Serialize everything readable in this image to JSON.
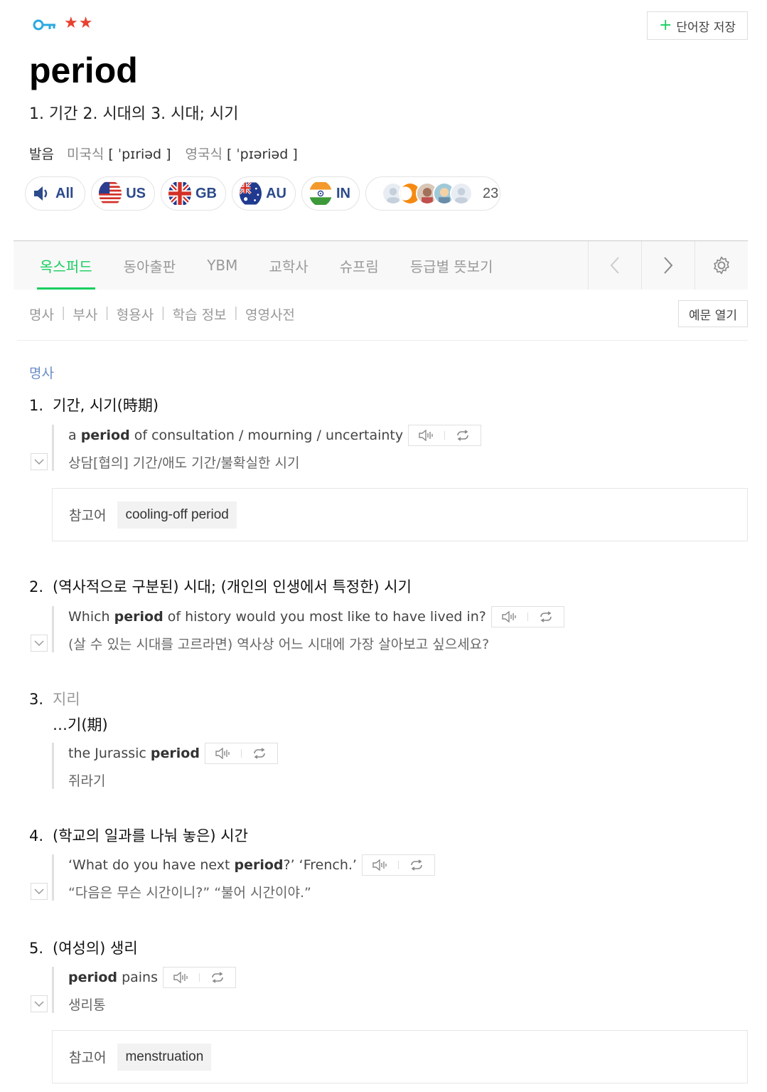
{
  "header": {
    "stars": "★★",
    "save_label": "단어장 저장",
    "save_plus": "+"
  },
  "entry": {
    "word": "period",
    "summary": "1. 기간 2. 시대의 3. 시대; 시기",
    "pron_label": "발음",
    "us_label": "미국식",
    "us_ipa": "[ ˈpɪriəd ]",
    "uk_label": "영국식",
    "uk_ipa": "[ ˈpɪəriəd ]"
  },
  "accents": [
    {
      "label": "All",
      "icon": "speaker-icon"
    },
    {
      "label": "US",
      "icon": "us-flag-icon"
    },
    {
      "label": "GB",
      "icon": "gb-flag-icon"
    },
    {
      "label": "AU",
      "icon": "au-flag-icon"
    },
    {
      "label": "IN",
      "icon": "in-flag-icon"
    }
  ],
  "contributors_count": "23",
  "tabs": [
    "옥스퍼드",
    "동아출판",
    "YBM",
    "교학사",
    "슈프림",
    "등급별 뜻보기"
  ],
  "active_tab": "옥스퍼드",
  "pos_filters": [
    "명사",
    "부사",
    "형용사",
    "학습 정보",
    "영영사전"
  ],
  "examples_open_label": "예문 열기",
  "section_pos": "명사",
  "ref_label": "참고어",
  "senses": [
    {
      "num": "1.",
      "def": "기간, 시기(時期)",
      "ex_pre": "a ",
      "ex_bold": "period",
      "ex_post": " of consultation / mourning / uncertainty",
      "ko": "상담[협의] 기간/애도 기간/불확실한 시기",
      "ref": "cooling-off period"
    },
    {
      "num": "2.",
      "def": "(역사적으로 구분된) 시대; (개인의 인생에서 특정한) 시기",
      "ex_pre": "Which ",
      "ex_bold": "period",
      "ex_post": " of history would you most like to have lived in?",
      "ko": "(살 수 있는 시대를 고르라면) 역사상 어느 시대에 가장 살아보고 싶으세요?"
    },
    {
      "num": "3.",
      "subject": "지리",
      "def": "…기(期)",
      "ex_pre": "the Jurassic ",
      "ex_bold": "period",
      "ex_post": "",
      "ko": "쥐라기"
    },
    {
      "num": "4.",
      "def": "(학교의 일과를 나눠 놓은) 시간",
      "ex_pre": "‘What do you have next ",
      "ex_bold": "period",
      "ex_post": "?’ ‘French.’",
      "ko": "“다음은 무슨 시간이니?” “불어 시간이야.”"
    },
    {
      "num": "5.",
      "def": "(여성의) 생리",
      "ex_pre": "",
      "ex_bold": "period",
      "ex_post": " pains",
      "ko": "생리통",
      "ref": "menstruation"
    }
  ],
  "colors": {
    "accent": "#19ce60",
    "star": "#e8412f",
    "key": "#2aa9e0",
    "accent_text": "#2c4a8b",
    "pos_head": "#6b8ec7"
  }
}
